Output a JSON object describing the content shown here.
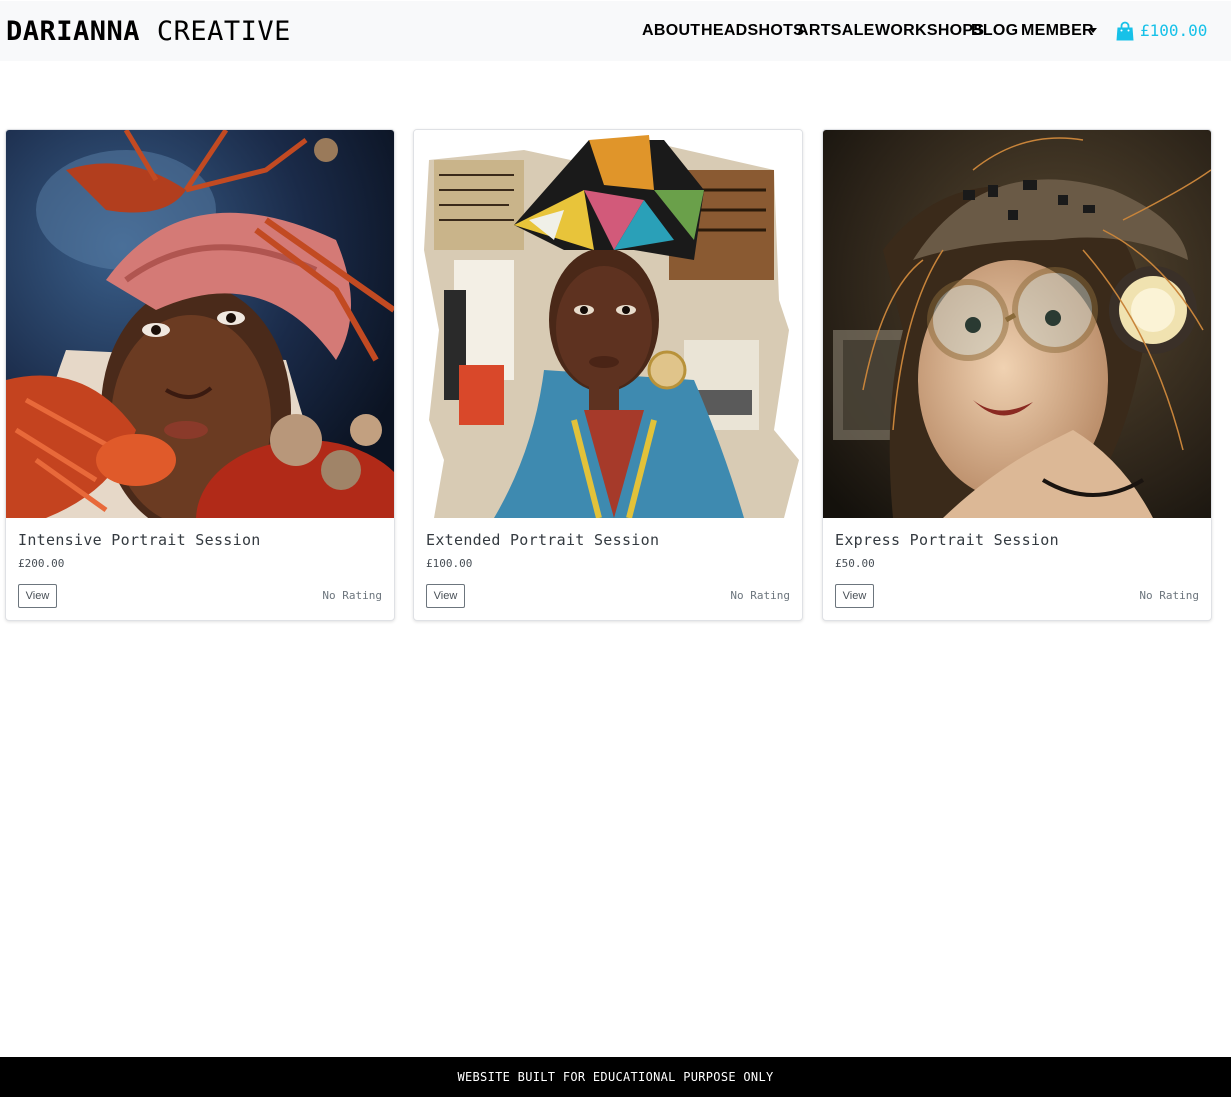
{
  "brand": {
    "bold": "DARIANNA",
    "light": "CREATIVE"
  },
  "nav": {
    "items": [
      {
        "label": "ABOUT"
      },
      {
        "label": "HEADSHOTS"
      },
      {
        "label": "ARTSALE"
      },
      {
        "label": "WORKSHOPS"
      },
      {
        "label": "BLOG"
      },
      {
        "label": "MEMBER"
      }
    ],
    "member_dropdown_icon": "caret-down-icon",
    "cart_icon": "shopping-bag-icon",
    "cart_total": "£100.00"
  },
  "colors": {
    "navbar_bg": "#f8f9fa",
    "accent": "#17c1e8",
    "footer_bg": "#000000"
  },
  "products": [
    {
      "title": "Intensive Portrait Session",
      "price": "£200.00",
      "button": "View",
      "rating": "No Rating"
    },
    {
      "title": "Extended Portrait Session",
      "price": "£100.00",
      "button": "View",
      "rating": "No Rating"
    },
    {
      "title": "Express Portrait Session",
      "price": "£50.00",
      "button": "View",
      "rating": "No Rating"
    }
  ],
  "footer": {
    "text": "WEBSITE BUILT FOR EDUCATIONAL PURPOSE ONLY"
  }
}
